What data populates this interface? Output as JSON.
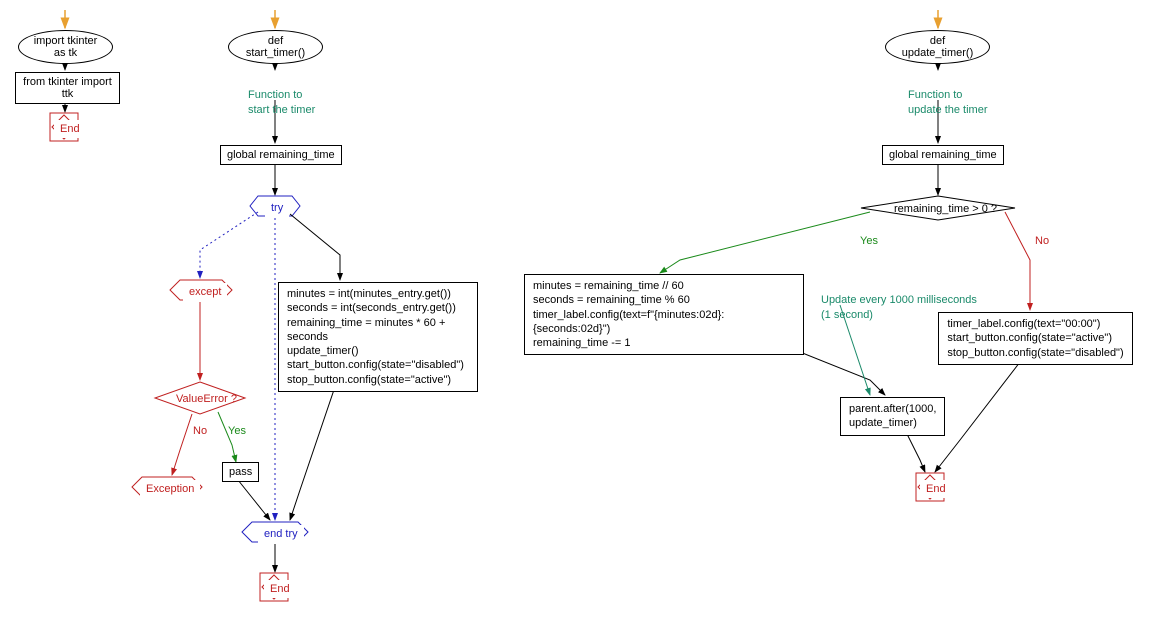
{
  "diagram": {
    "flow1": {
      "import": "import tkinter as tk",
      "from": "from tkinter import ttk",
      "end": "End"
    },
    "flow2": {
      "def": "def start_timer()",
      "comment": "Function to\nstart the timer",
      "global": "global remaining_time",
      "try": "try",
      "try_body": "minutes = int(minutes_entry.get())\nseconds = int(seconds_entry.get())\nremaining_time = minutes * 60 + seconds\nupdate_timer()\nstart_button.config(state=\"disabled\")\nstop_button.config(state=\"active\")",
      "except": "except",
      "value_error": "ValueError ?",
      "exception": "Exception",
      "pass": "pass",
      "yes": "Yes",
      "no": "No",
      "end_try": "end try",
      "end": "End"
    },
    "flow3": {
      "def": "def update_timer()",
      "comment": "Function to\nupdate the timer",
      "global": "global remaining_time",
      "condition": "remaining_time > 0 ?",
      "yes_body": "minutes = remaining_time // 60\nseconds = remaining_time % 60\ntimer_label.config(text=f\"{minutes:02d}:{seconds:02d}\")\nremaining_time -= 1",
      "after_comment": "Update every 1000 milliseconds\n(1 second)",
      "after_body": "parent.after(1000,\nupdate_timer)",
      "no_body": "timer_label.config(text=\"00:00\")\nstart_button.config(state=\"active\")\nstop_button.config(state=\"disabled\")",
      "yes": "Yes",
      "no": "No",
      "end": "End"
    }
  }
}
